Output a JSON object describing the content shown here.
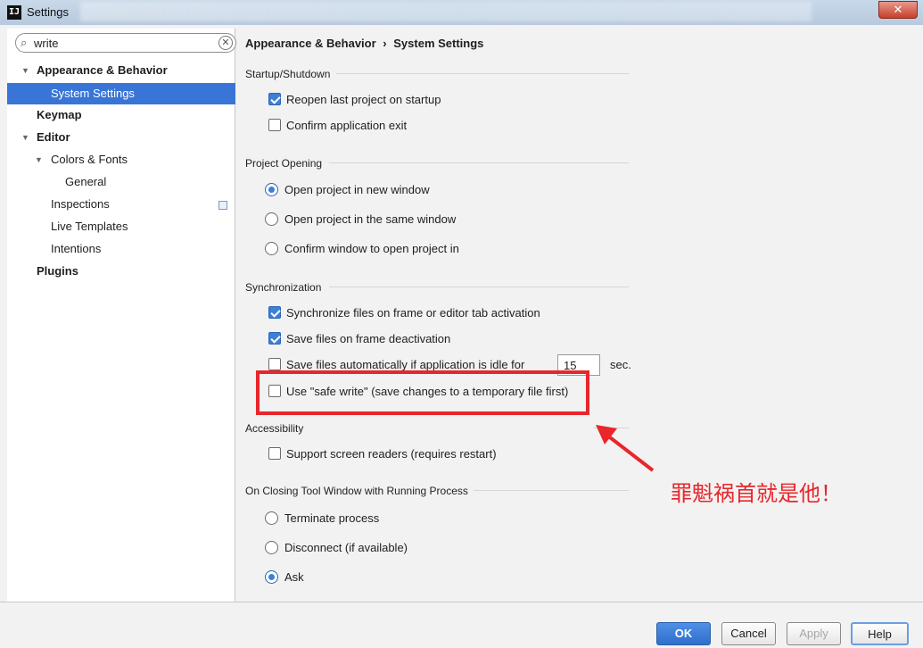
{
  "window": {
    "title": "Settings",
    "app_icon_glyph": "IJ",
    "close_glyph": "✕"
  },
  "search": {
    "value": "write",
    "icon": "search-icon",
    "clear_glyph": "✕"
  },
  "sidebar": {
    "items": [
      {
        "label": "Appearance & Behavior",
        "expanded": true
      },
      {
        "label": "System Settings",
        "selected": true
      },
      {
        "label": "Keymap"
      },
      {
        "label": "Editor",
        "expanded": true
      },
      {
        "label": "Colors & Fonts",
        "expanded": true
      },
      {
        "label": "General"
      },
      {
        "label": "Inspections"
      },
      {
        "label": "Live Templates"
      },
      {
        "label": "Intentions"
      },
      {
        "label": "Plugins"
      }
    ]
  },
  "breadcrumb": {
    "parent": "Appearance & Behavior",
    "separator": "›",
    "current": "System Settings"
  },
  "sections": {
    "startup": {
      "title": "Startup/Shutdown",
      "reopen": {
        "label": "Reopen last project on startup",
        "checked": true
      },
      "confirm_exit": {
        "label": "Confirm application exit",
        "checked": false
      }
    },
    "project_opening": {
      "title": "Project Opening",
      "options": [
        {
          "label": "Open project in new window",
          "selected": true
        },
        {
          "label": "Open project in the same window",
          "selected": false
        },
        {
          "label": "Confirm window to open project in",
          "selected": false
        }
      ]
    },
    "sync": {
      "title": "Synchronization",
      "sync_files": {
        "label": "Synchronize files on frame or editor tab activation",
        "checked": true
      },
      "save_deactivation": {
        "label": "Save files on frame deactivation",
        "checked": true
      },
      "save_idle": {
        "label": "Save files automatically if application is idle for",
        "checked": false,
        "value": "15",
        "unit": "sec."
      },
      "safe_write": {
        "label": "Use \"safe write\" (save changes to a temporary file first)",
        "checked": false
      }
    },
    "accessibility": {
      "title": "Accessibility",
      "screen_readers": {
        "label": "Support screen readers (requires restart)",
        "checked": false
      }
    },
    "closing": {
      "title": "On Closing Tool Window with Running Process",
      "options": [
        {
          "label": "Terminate process",
          "selected": false
        },
        {
          "label": "Disconnect (if available)",
          "selected": false
        },
        {
          "label": "Ask",
          "selected": true
        }
      ]
    }
  },
  "annotation": {
    "text": "罪魁祸首就是他！",
    "color": "#e8262b"
  },
  "buttons": {
    "ok": "OK",
    "cancel": "Cancel",
    "apply": "Apply",
    "help": "Help"
  },
  "colors": {
    "accent": "#3875d7",
    "highlight": "#e8262b"
  }
}
